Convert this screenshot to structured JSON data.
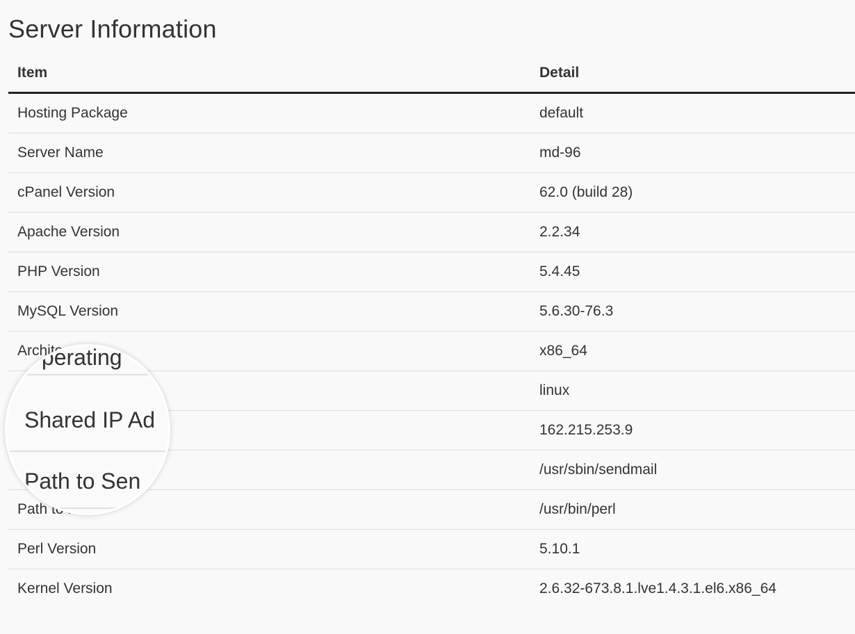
{
  "page": {
    "title": "Server Information"
  },
  "table": {
    "headers": {
      "item": "Item",
      "detail": "Detail"
    },
    "rows": [
      {
        "item": "Hosting Package",
        "detail": "default"
      },
      {
        "item": "Server Name",
        "detail": "md-96"
      },
      {
        "item": "cPanel Version",
        "detail": "62.0 (build 28)"
      },
      {
        "item": "Apache Version",
        "detail": "2.2.34"
      },
      {
        "item": "PHP Version",
        "detail": "5.4.45"
      },
      {
        "item": "MySQL Version",
        "detail": "5.6.30-76.3"
      },
      {
        "item": "Architecture",
        "detail": "x86_64"
      },
      {
        "item": "Operating System",
        "detail": "linux"
      },
      {
        "item": "Shared IP Address",
        "detail": "162.215.253.9"
      },
      {
        "item": "Path to Sendmail",
        "detail": "/usr/sbin/sendmail"
      },
      {
        "item": "Path to Perl",
        "detail": "/usr/bin/perl"
      },
      {
        "item": "Perl Version",
        "detail": "5.10.1"
      },
      {
        "item": "Kernel Version",
        "detail": "2.6.32-673.8.1.lve1.4.3.1.el6.x86_64"
      }
    ]
  },
  "magnifier": {
    "lines": [
      "Operating",
      "Shared IP Ad",
      "Path to Sen"
    ]
  }
}
